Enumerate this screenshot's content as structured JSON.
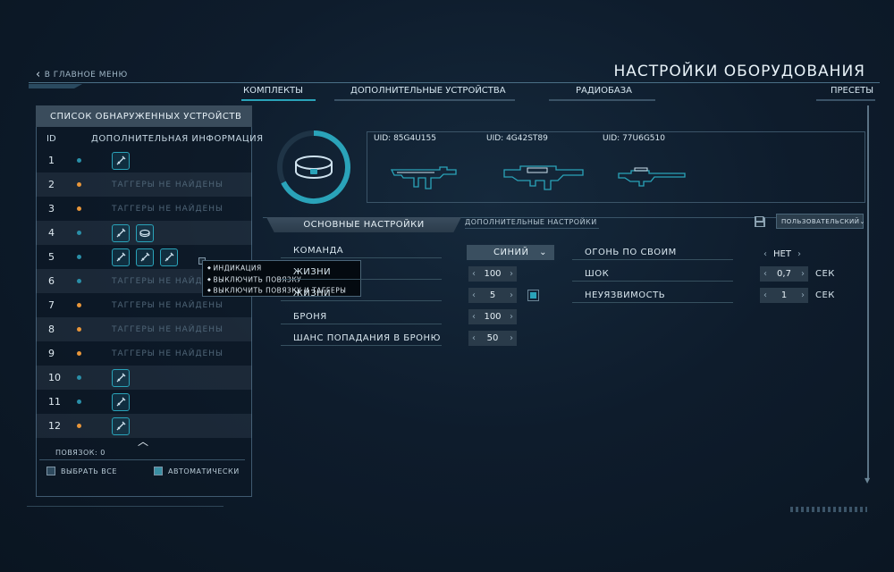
{
  "header": {
    "back_label": "В ГЛАВНОЕ МЕНЮ",
    "title": "НАСТРОЙКИ ОБОРУДОВАНИЯ"
  },
  "tabs": [
    {
      "label": "КОМПЛЕКТЫ",
      "active": true
    },
    {
      "label": "ДОПОЛНИТЕЛЬНЫЕ УСТРОЙСТВА",
      "active": false
    },
    {
      "label": "РАДИОБАЗА",
      "active": false
    },
    {
      "label": "ПРЕСЕТЫ",
      "active": false
    }
  ],
  "device_list": {
    "title": "СПИСОК ОБНАРУЖЕННЫХ УСТРОЙСТВ",
    "col_id": "ID",
    "col_info": "ДОПОЛНИТЕЛЬНАЯ ИНФОРМАЦИЯ",
    "empty_text": "ТАГГЕРЫ НЕ НАЙДЕНЫ",
    "rows": [
      {
        "id": "1",
        "status": "teal",
        "devices": [
          "rifle"
        ]
      },
      {
        "id": "2",
        "status": "orange",
        "devices": []
      },
      {
        "id": "3",
        "status": "orange",
        "devices": []
      },
      {
        "id": "4",
        "status": "teal",
        "devices": [
          "rifle",
          "headband"
        ]
      },
      {
        "id": "5",
        "status": "teal",
        "devices": [
          "rifle",
          "rifle",
          "rifle"
        ]
      },
      {
        "id": "6",
        "status": "teal",
        "devices": []
      },
      {
        "id": "7",
        "status": "orange",
        "devices": []
      },
      {
        "id": "8",
        "status": "orange",
        "devices": []
      },
      {
        "id": "9",
        "status": "orange",
        "devices": []
      },
      {
        "id": "10",
        "status": "teal",
        "devices": [
          "rifle"
        ]
      },
      {
        "id": "11",
        "status": "teal",
        "devices": [
          "rifle"
        ]
      },
      {
        "id": "12",
        "status": "orange",
        "devices": [
          "rifle"
        ]
      }
    ],
    "counter": "ПОВЯЗОК: 0",
    "select_all": "ВЫБРАТЬ ВСЕ",
    "auto": "АВТОМАТИЧЕСКИ"
  },
  "context_menu": {
    "items": [
      "ИНДИКАЦИЯ",
      "ВЫКЛЮЧИТЬ ПОВЯЗКУ",
      "ВЫКЛЮЧИТЬ ПОВЯЗКУ И ТАГГЕРЫ"
    ]
  },
  "kit": {
    "uids": [
      "UID: 85G4U155",
      "UID: 4G42ST89",
      "UID: 77U6G510"
    ]
  },
  "settings": {
    "tab_main": "ОСНОВНЫЕ НАСТРОЙКИ",
    "tab_extra": "ДОПОЛНИТЕЛЬНЫЕ НАСТРОЙКИ",
    "preset": "ПОЛЬЗОВАТЕЛЬСКИЙ",
    "team_label": "КОМАНДА",
    "team_value": "СИНИЙ",
    "health_label": "ЖИЗНИ",
    "health_value": "100",
    "lives_label": "ЖИЗНИ",
    "lives_value": "5",
    "armor_label": "БРОНЯ",
    "armor_value": "100",
    "armor_hit_label": "ШАНС ПОПАДАНИЯ В БРОНЮ",
    "armor_hit_value": "50",
    "ff_label": "ОГОНЬ ПО СВОИМ",
    "ff_value": "НЕТ",
    "shock_label": "ШОК",
    "shock_value": "0,7",
    "shock_unit": "СЕК",
    "invuln_label": "НЕУЯЗВИМОСТЬ",
    "invuln_value": "1",
    "invuln_unit": "СЕК"
  },
  "colors": {
    "accent": "#2aa3b9",
    "orange": "#e8963a",
    "teal": "#2a8fa8"
  }
}
